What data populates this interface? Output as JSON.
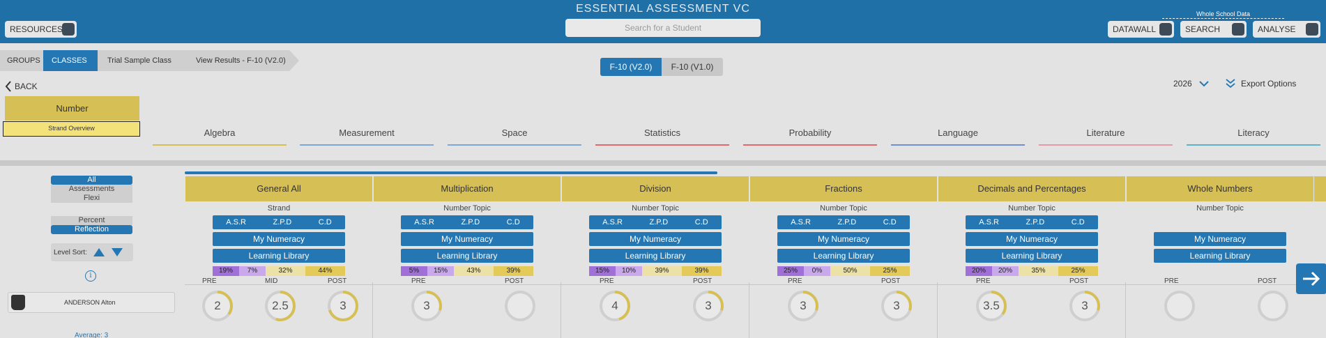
{
  "header": {
    "title": "ESSENTIAL ASSESSMENT VC",
    "search_placeholder": "Search for a Student",
    "resources_label": "RESOURCES",
    "whole_school_label": "Whole School Data",
    "datawall_label": "DATAWALL",
    "search_label": "SEARCH",
    "analyse_label": "ANALYSE"
  },
  "breadcrumb": {
    "groups": "GROUPS",
    "classes": "CLASSES",
    "class_name": "Trial Sample Class",
    "view": "View Results - F-10 (V2.0)"
  },
  "versions": {
    "active": "F-10 (V2.0)",
    "inactive": "F-10 (V1.0)"
  },
  "nav": {
    "back": "BACK",
    "year": "2026",
    "export": "Export Options"
  },
  "strand": {
    "selected": "Number",
    "overview": "Strand Overview",
    "tabs": [
      {
        "label": "Algebra",
        "color": "#d6bf55"
      },
      {
        "label": "Measurement",
        "color": "#7fa6d8"
      },
      {
        "label": "Space",
        "color": "#7fa6d8"
      },
      {
        "label": "Statistics",
        "color": "#e06a6a"
      },
      {
        "label": "Probability",
        "color": "#e06a6a"
      },
      {
        "label": "Language",
        "color": "#6f8fd0"
      },
      {
        "label": "Literature",
        "color": "#e79aa6"
      },
      {
        "label": "Literacy",
        "color": "#5fb3c6"
      }
    ]
  },
  "filters": {
    "assessments": [
      "All",
      "Assessments",
      "Flexi"
    ],
    "display": [
      "Percent",
      "Reflection"
    ],
    "level_sort": "Level Sort:"
  },
  "student": {
    "name": "ANDERSON Alton",
    "average": "Average: 3"
  },
  "labels": {
    "asr": "A.S.R",
    "zpd": "Z.P.D",
    "cd": "C.D",
    "my_numeracy": "My Numeracy",
    "learning_library": "Learning Library",
    "pre": "PRE",
    "mid": "MID",
    "post": "POST"
  },
  "topics": [
    {
      "title": "General All",
      "subtitle": "Strand",
      "has_asr": true,
      "bar": [
        "19%",
        "7%",
        "32%",
        "44%"
      ],
      "scores": [
        {
          "value": "2",
          "fill": 0.35
        },
        {
          "value": "2.5",
          "fill": 0.55
        },
        {
          "value": "3",
          "fill": 0.7
        }
      ]
    },
    {
      "title": "Multiplication",
      "subtitle": "Number Topic",
      "has_asr": true,
      "bar": [
        "5%",
        "15%",
        "43%",
        "39%"
      ],
      "scores": [
        {
          "value": "3",
          "fill": 0.3
        },
        {
          "value": "",
          "fill": 0
        }
      ]
    },
    {
      "title": "Division",
      "subtitle": "Number Topic",
      "has_asr": true,
      "bar": [
        "15%",
        "10%",
        "39%",
        "39%"
      ],
      "scores": [
        {
          "value": "4",
          "fill": 0.45
        },
        {
          "value": "3",
          "fill": 0.3
        }
      ]
    },
    {
      "title": "Fractions",
      "subtitle": "Number Topic",
      "has_asr": true,
      "bar": [
        "25%",
        "0%",
        "50%",
        "25%"
      ],
      "scores": [
        {
          "value": "3",
          "fill": 0.3
        },
        {
          "value": "3",
          "fill": 0.3
        }
      ]
    },
    {
      "title": "Decimals and Percentages",
      "subtitle": "Number Topic",
      "has_asr": true,
      "bar": [
        "20%",
        "20%",
        "35%",
        "25%"
      ],
      "scores": [
        {
          "value": "3.5",
          "fill": 0.35
        },
        {
          "value": "3",
          "fill": 0.3
        }
      ]
    },
    {
      "title": "Whole Numbers",
      "subtitle": "Number Topic",
      "has_asr": false,
      "bar": [],
      "scores": [
        {
          "value": "",
          "fill": 0
        },
        {
          "value": "",
          "fill": 0
        }
      ]
    }
  ],
  "colors": {
    "primary": "#2477b3",
    "header": "#2070a8",
    "gold": "#d6bf55",
    "bar_colors": [
      "#a070d8",
      "#c9a9ec",
      "#ece1a6",
      "#e4cb59"
    ]
  }
}
